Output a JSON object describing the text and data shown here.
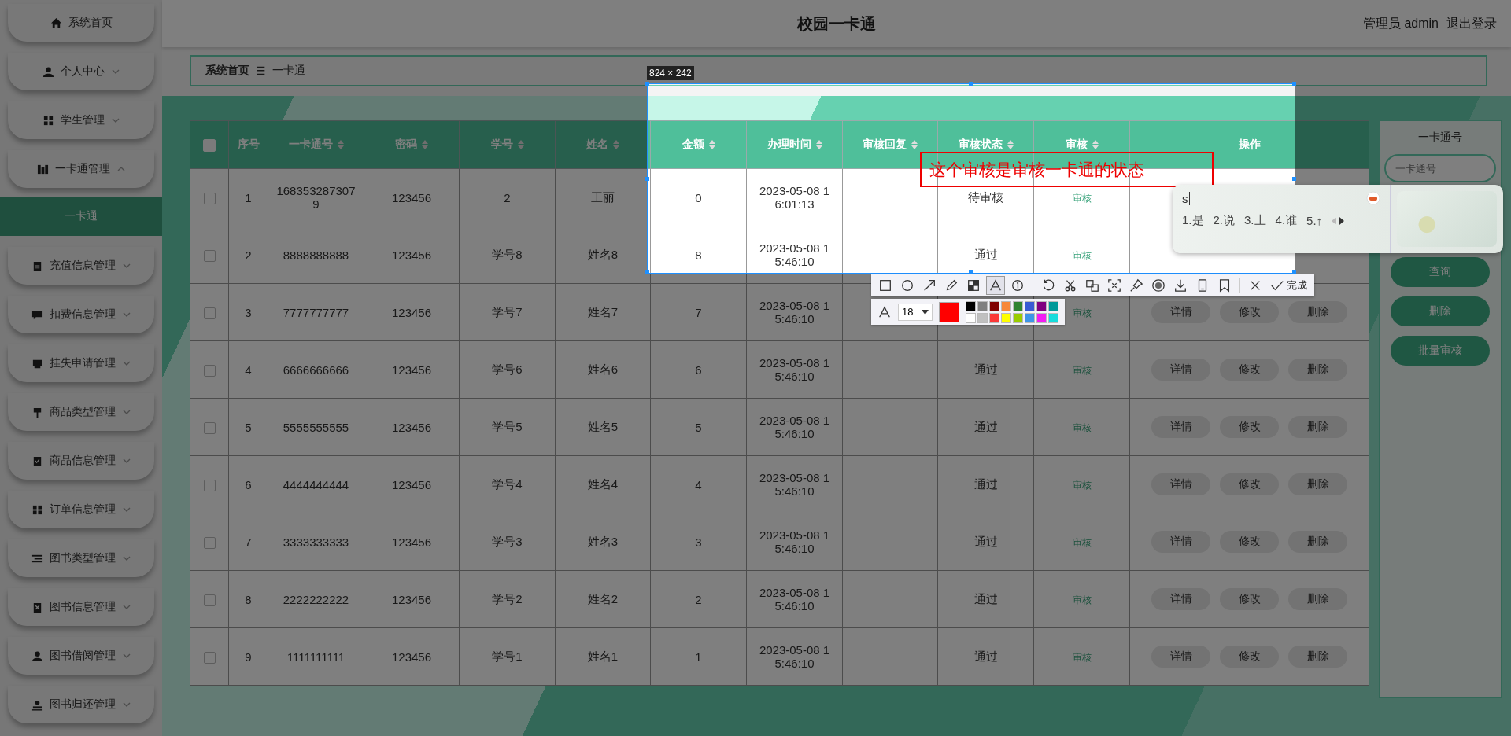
{
  "header": {
    "title": "校园一卡通",
    "user": "管理员 admin",
    "logout": "退出登录"
  },
  "sidebar": {
    "items": [
      {
        "label": "系统首页"
      },
      {
        "label": "个人中心",
        "expanded": false
      },
      {
        "label": "学生管理",
        "expanded": false
      },
      {
        "label": "一卡通管理",
        "expanded": true,
        "children": [
          {
            "label": "一卡通",
            "selected": true
          }
        ]
      },
      {
        "label": "充值信息管理",
        "expanded": false
      },
      {
        "label": "扣费信息管理",
        "expanded": false
      },
      {
        "label": "挂失申请管理",
        "expanded": false
      },
      {
        "label": "商品类型管理",
        "expanded": false
      },
      {
        "label": "商品信息管理",
        "expanded": false
      },
      {
        "label": "订单信息管理",
        "expanded": false
      },
      {
        "label": "图书类型管理",
        "expanded": false
      },
      {
        "label": "图书信息管理",
        "expanded": false
      },
      {
        "label": "图书借阅管理",
        "expanded": false
      },
      {
        "label": "图书归还管理",
        "expanded": false
      }
    ]
  },
  "breadcrumb": {
    "items": [
      "系统首页",
      "一卡通"
    ],
    "separator": "☰"
  },
  "table": {
    "header_checkbox": {
      "checked": false
    },
    "columns": [
      {
        "label": "序号",
        "sortable": false
      },
      {
        "label": "一卡通号",
        "sortable": true
      },
      {
        "label": "密码",
        "sortable": true
      },
      {
        "label": "学号",
        "sortable": true
      },
      {
        "label": "姓名",
        "sortable": true
      },
      {
        "label": "金额",
        "sortable": true
      },
      {
        "label": "办理时间",
        "sortable": true
      },
      {
        "label": "审核回复",
        "sortable": true
      },
      {
        "label": "审核状态",
        "sortable": true
      },
      {
        "label": "审核",
        "sortable": true
      },
      {
        "label": "操作",
        "sortable": false
      }
    ],
    "rows": [
      {
        "checked": false,
        "index": "1",
        "card_no": "1683532873079",
        "password": "123456",
        "student_no": "2",
        "name": "王丽",
        "amount": "0",
        "time": "2023-05-08 16:01:13",
        "status": "待审核",
        "review": "审核"
      },
      {
        "checked": false,
        "index": "2",
        "card_no": "8888888888",
        "password": "123456",
        "student_no": "学号8",
        "name": "姓名8",
        "amount": "8",
        "time": "2023-05-08 15:46:10",
        "status": "通过",
        "review": "审核"
      },
      {
        "checked": false,
        "index": "3",
        "card_no": "7777777777",
        "password": "123456",
        "student_no": "学号7",
        "name": "姓名7",
        "amount": "7",
        "time": "2023-05-08 15:46:10",
        "review": "审核",
        "actions": [
          "详情",
          "修改",
          "删除"
        ]
      },
      {
        "checked": false,
        "index": "4",
        "card_no": "6666666666",
        "password": "123456",
        "student_no": "学号6",
        "name": "姓名6",
        "amount": "6",
        "time": "2023-05-08 15:46:10",
        "status": "通过",
        "review": "审核",
        "actions": [
          "详情",
          "修改",
          "删除"
        ]
      },
      {
        "checked": false,
        "index": "5",
        "card_no": "5555555555",
        "password": "123456",
        "student_no": "学号5",
        "name": "姓名5",
        "amount": "5",
        "time": "2023-05-08 15:46:10",
        "status": "通过",
        "review": "审核",
        "actions": [
          "详情",
          "修改",
          "删除"
        ]
      },
      {
        "checked": false,
        "index": "6",
        "card_no": "4444444444",
        "password": "123456",
        "student_no": "学号4",
        "name": "姓名4",
        "amount": "4",
        "time": "2023-05-08 15:46:10",
        "status": "通过",
        "review": "审核",
        "actions": [
          "详情",
          "修改",
          "删除"
        ]
      },
      {
        "checked": false,
        "index": "7",
        "card_no": "3333333333",
        "password": "123456",
        "student_no": "学号3",
        "name": "姓名3",
        "amount": "3",
        "time": "2023-05-08 15:46:10",
        "status": "通过",
        "review": "审核",
        "actions": [
          "详情",
          "修改",
          "删除"
        ]
      },
      {
        "checked": false,
        "index": "8",
        "card_no": "2222222222",
        "password": "123456",
        "student_no": "学号2",
        "name": "姓名2",
        "amount": "2",
        "time": "2023-05-08 15:46:10",
        "status": "通过",
        "review": "审核",
        "actions": [
          "详情",
          "修改",
          "删除"
        ]
      },
      {
        "checked": false,
        "index": "9",
        "card_no": "1111111111",
        "password": "123456",
        "student_no": "学号1",
        "name": "姓名1",
        "amount": "1",
        "time": "2023-05-08 15:46:10",
        "status": "通过",
        "review": "审核",
        "actions": [
          "详情",
          "修改",
          "删除"
        ]
      }
    ]
  },
  "search_panel": {
    "title": "一卡通号",
    "placeholder": "一卡通号",
    "buttons": [
      "查询",
      "删除",
      "批量审核"
    ]
  },
  "capture": {
    "size_label": "824 × 242",
    "annotation": "这个审核是审核一卡通的状态",
    "tools": [
      {
        "kind": "rect",
        "selected": false
      },
      {
        "kind": "ellipse",
        "selected": false
      },
      {
        "kind": "arrow",
        "selected": false
      },
      {
        "kind": "pencil",
        "selected": false
      },
      {
        "kind": "mosaic",
        "selected": false
      },
      {
        "kind": "text",
        "selected": true
      },
      {
        "kind": "number",
        "selected": false
      },
      {
        "kind": "undo",
        "selected": false
      },
      {
        "kind": "cut",
        "selected": false
      },
      {
        "kind": "translate",
        "selected": false
      },
      {
        "kind": "ocr",
        "selected": false
      },
      {
        "kind": "pin",
        "selected": false
      },
      {
        "kind": "record",
        "selected": false
      },
      {
        "kind": "download",
        "selected": false
      },
      {
        "kind": "phone",
        "selected": false
      },
      {
        "kind": "bookmark",
        "selected": false
      },
      {
        "kind": "close",
        "selected": false
      },
      {
        "kind": "done",
        "label": "完成",
        "selected": false
      }
    ],
    "font_size": "18",
    "current_swatch": {
      "color": "#ff0000"
    },
    "palette": [
      {
        "color": "#000000"
      },
      {
        "color": "#808080"
      },
      {
        "color": "#800000"
      },
      {
        "color": "#f7883a"
      },
      {
        "color": "#308430"
      },
      {
        "color": "#385ad3"
      },
      {
        "color": "#800080"
      },
      {
        "color": "#009999"
      },
      {
        "color": "#ffffff"
      },
      {
        "color": "#c0c0c0"
      },
      {
        "color": "#fb3838"
      },
      {
        "color": "#ffff00"
      },
      {
        "color": "#99cc00"
      },
      {
        "color": "#3d95e8"
      },
      {
        "color": "#f31bf3"
      },
      {
        "color": "#16dcdc"
      }
    ]
  },
  "ime": {
    "input": "s",
    "candidates": [
      "1.是",
      "2.说",
      "3.上",
      "4.谁",
      "5.↑"
    ]
  }
}
